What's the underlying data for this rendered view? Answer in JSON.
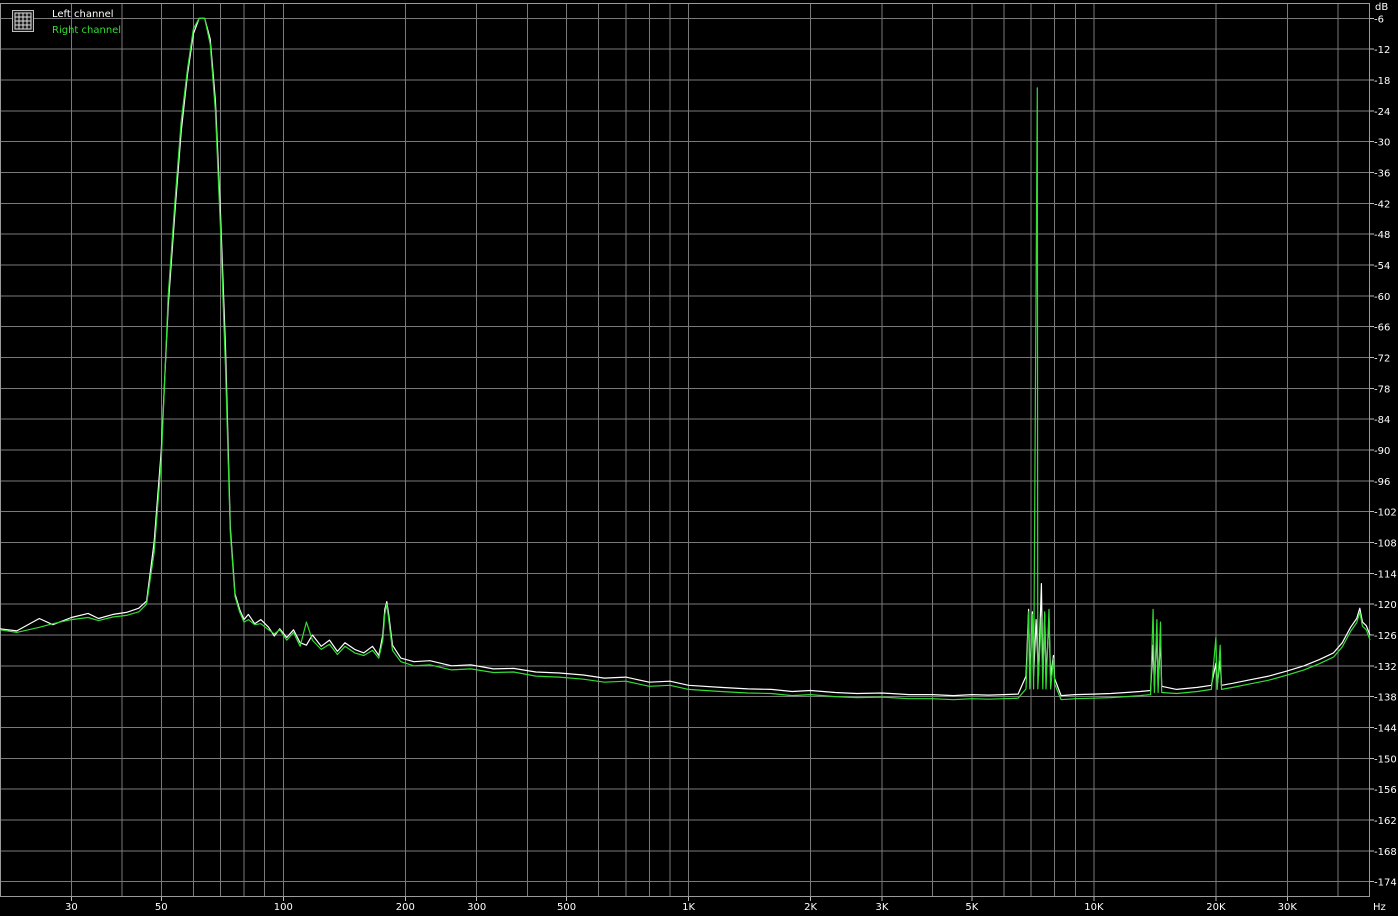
{
  "chart_data": {
    "type": "line",
    "title": "",
    "x_scale": "log",
    "xlim": [
      20,
      48000
    ],
    "ylim": [
      -177,
      -3
    ],
    "grid": true,
    "legend_position": "top-left",
    "x_unit": "Hz",
    "y_unit": "dB",
    "x_ticks": [
      {
        "value": 30,
        "label": "30"
      },
      {
        "value": 50,
        "label": "50"
      },
      {
        "value": 100,
        "label": "100"
      },
      {
        "value": 200,
        "label": "200"
      },
      {
        "value": 300,
        "label": "300"
      },
      {
        "value": 500,
        "label": "500"
      },
      {
        "value": 1000,
        "label": "1K"
      },
      {
        "value": 2000,
        "label": "2K"
      },
      {
        "value": 3000,
        "label": "3K"
      },
      {
        "value": 5000,
        "label": "5K"
      },
      {
        "value": 10000,
        "label": "10K"
      },
      {
        "value": 20000,
        "label": "20K"
      },
      {
        "value": 30000,
        "label": "30K"
      }
    ],
    "y_ticks": [
      -6,
      -12,
      -18,
      -24,
      -30,
      -36,
      -42,
      -48,
      -54,
      -60,
      -66,
      -72,
      -78,
      -84,
      -90,
      -96,
      -102,
      -108,
      -114,
      -120,
      -126,
      -132,
      -138,
      -144,
      -150,
      -156,
      -162,
      -168,
      -174
    ],
    "series": [
      {
        "name": "Left channel",
        "color": "#ffffff",
        "points": [
          [
            20,
            -124.8
          ],
          [
            22,
            -125.2
          ],
          [
            25,
            -122.8
          ],
          [
            27,
            -124.0
          ],
          [
            30,
            -122.6
          ],
          [
            33,
            -121.8
          ],
          [
            35,
            -122.8
          ],
          [
            38,
            -122.0
          ],
          [
            41,
            -121.6
          ],
          [
            44,
            -120.8
          ],
          [
            46,
            -119.4
          ],
          [
            48,
            -108
          ],
          [
            50,
            -90
          ],
          [
            52,
            -62
          ],
          [
            54,
            -44
          ],
          [
            56,
            -28
          ],
          [
            58,
            -17
          ],
          [
            60,
            -9
          ],
          [
            62,
            -6
          ],
          [
            64,
            -6
          ],
          [
            66,
            -10
          ],
          [
            68,
            -22
          ],
          [
            70,
            -44
          ],
          [
            72,
            -70
          ],
          [
            74,
            -105
          ],
          [
            76,
            -118
          ],
          [
            78,
            -121
          ],
          [
            80,
            -123
          ],
          [
            82,
            -122
          ],
          [
            85,
            -123.8
          ],
          [
            88,
            -123.0
          ],
          [
            92,
            -124.5
          ],
          [
            95,
            -126.2
          ],
          [
            98,
            -124.8
          ],
          [
            102,
            -126.5
          ],
          [
            106,
            -125.0
          ],
          [
            110,
            -127.5
          ],
          [
            114,
            -128.0
          ],
          [
            118,
            -126.0
          ],
          [
            124,
            -128.2
          ],
          [
            130,
            -127.0
          ],
          [
            136,
            -129.2
          ],
          [
            142,
            -127.5
          ],
          [
            150,
            -128.8
          ],
          [
            158,
            -129.5
          ],
          [
            166,
            -128.2
          ],
          [
            172,
            -130.0
          ],
          [
            176,
            -126
          ],
          [
            178,
            -121
          ],
          [
            180,
            -119.5
          ],
          [
            182,
            -122
          ],
          [
            186,
            -128
          ],
          [
            195,
            -130.5
          ],
          [
            210,
            -131.2
          ],
          [
            230,
            -131.0
          ],
          [
            260,
            -132.0
          ],
          [
            290,
            -131.8
          ],
          [
            330,
            -132.6
          ],
          [
            370,
            -132.5
          ],
          [
            420,
            -133.2
          ],
          [
            480,
            -133.4
          ],
          [
            550,
            -133.8
          ],
          [
            620,
            -134.4
          ],
          [
            700,
            -134.2
          ],
          [
            800,
            -135.2
          ],
          [
            900,
            -135.0
          ],
          [
            1000,
            -135.8
          ],
          [
            1200,
            -136.2
          ],
          [
            1400,
            -136.5
          ],
          [
            1600,
            -136.6
          ],
          [
            1800,
            -137.0
          ],
          [
            2000,
            -136.8
          ],
          [
            2300,
            -137.2
          ],
          [
            2600,
            -137.4
          ],
          [
            3000,
            -137.3
          ],
          [
            3500,
            -137.6
          ],
          [
            4000,
            -137.6
          ],
          [
            4500,
            -137.8
          ],
          [
            5000,
            -137.6
          ],
          [
            5500,
            -137.7
          ],
          [
            6000,
            -137.6
          ],
          [
            6500,
            -137.5
          ],
          [
            6800,
            -134.0
          ],
          [
            6900,
            -121.0
          ],
          [
            6950,
            -134.0
          ],
          [
            7050,
            -121.5
          ],
          [
            7100,
            -134.0
          ],
          [
            7200,
            -123.0
          ],
          [
            7300,
            -134.0
          ],
          [
            7420,
            -116.0
          ],
          [
            7480,
            -134.0
          ],
          [
            7560,
            -122.0
          ],
          [
            7620,
            -134.0
          ],
          [
            7750,
            -123.0
          ],
          [
            7820,
            -134.0
          ],
          [
            7950,
            -130.0
          ],
          [
            8000,
            -134.5
          ],
          [
            8300,
            -137.8
          ],
          [
            9000,
            -137.6
          ],
          [
            10000,
            -137.5
          ],
          [
            11000,
            -137.4
          ],
          [
            12000,
            -137.2
          ],
          [
            13000,
            -137.0
          ],
          [
            13800,
            -136.8
          ],
          [
            14000,
            -128.0
          ],
          [
            14100,
            -136.0
          ],
          [
            14300,
            -125.5
          ],
          [
            14400,
            -136.0
          ],
          [
            14600,
            -127.0
          ],
          [
            14700,
            -136.0
          ],
          [
            16000,
            -136.6
          ],
          [
            18000,
            -136.2
          ],
          [
            19500,
            -135.8
          ],
          [
            20000,
            -131.5
          ],
          [
            20150,
            -135.8
          ],
          [
            20500,
            -131.0
          ],
          [
            20650,
            -135.8
          ],
          [
            22000,
            -135.4
          ],
          [
            24000,
            -134.8
          ],
          [
            27000,
            -134.0
          ],
          [
            30000,
            -133.0
          ],
          [
            33000,
            -132.0
          ],
          [
            36000,
            -130.8
          ],
          [
            39000,
            -129.5
          ],
          [
            41000,
            -127.5
          ],
          [
            43000,
            -124.5
          ],
          [
            44500,
            -122.8
          ],
          [
            45300,
            -120.8
          ],
          [
            46000,
            -123.5
          ],
          [
            47000,
            -124.2
          ],
          [
            48000,
            -126.0
          ]
        ]
      },
      {
        "name": "Right channel",
        "color": "#33dd33",
        "points": [
          [
            20,
            -125.0
          ],
          [
            22,
            -125.5
          ],
          [
            25,
            -124.5
          ],
          [
            27,
            -123.8
          ],
          [
            30,
            -123.0
          ],
          [
            33,
            -122.6
          ],
          [
            35,
            -123.2
          ],
          [
            38,
            -122.5
          ],
          [
            41,
            -122.2
          ],
          [
            44,
            -121.5
          ],
          [
            46,
            -120.0
          ],
          [
            48,
            -110
          ],
          [
            50,
            -92
          ],
          [
            52,
            -60
          ],
          [
            54,
            -42
          ],
          [
            56,
            -26
          ],
          [
            58,
            -16
          ],
          [
            60,
            -8
          ],
          [
            62,
            -6
          ],
          [
            64,
            -6
          ],
          [
            66,
            -11
          ],
          [
            68,
            -24
          ],
          [
            70,
            -47
          ],
          [
            72,
            -74
          ],
          [
            74,
            -106
          ],
          [
            76,
            -118.5
          ],
          [
            78,
            -121.5
          ],
          [
            80,
            -123.5
          ],
          [
            82,
            -123
          ],
          [
            85,
            -124.0
          ],
          [
            88,
            -123.8
          ],
          [
            92,
            -125.0
          ],
          [
            95,
            -125.8
          ],
          [
            98,
            -125.0
          ],
          [
            102,
            -127.0
          ],
          [
            106,
            -125.5
          ],
          [
            110,
            -128.2
          ],
          [
            114,
            -123.5
          ],
          [
            118,
            -127.0
          ],
          [
            124,
            -128.8
          ],
          [
            130,
            -127.8
          ],
          [
            136,
            -129.8
          ],
          [
            142,
            -128.2
          ],
          [
            150,
            -129.5
          ],
          [
            158,
            -130.0
          ],
          [
            166,
            -129.0
          ],
          [
            172,
            -130.5
          ],
          [
            176,
            -127
          ],
          [
            178,
            -122
          ],
          [
            180,
            -120.0
          ],
          [
            182,
            -123
          ],
          [
            186,
            -129
          ],
          [
            195,
            -131.2
          ],
          [
            210,
            -132.0
          ],
          [
            230,
            -131.8
          ],
          [
            260,
            -132.8
          ],
          [
            290,
            -132.6
          ],
          [
            330,
            -133.3
          ],
          [
            370,
            -133.2
          ],
          [
            420,
            -134.0
          ],
          [
            480,
            -134.2
          ],
          [
            550,
            -134.6
          ],
          [
            620,
            -135.2
          ],
          [
            700,
            -135.0
          ],
          [
            800,
            -136.0
          ],
          [
            900,
            -135.8
          ],
          [
            1000,
            -136.6
          ],
          [
            1200,
            -137.0
          ],
          [
            1400,
            -137.3
          ],
          [
            1600,
            -137.4
          ],
          [
            1800,
            -137.8
          ],
          [
            2000,
            -137.6
          ],
          [
            2300,
            -138.0
          ],
          [
            2600,
            -138.2
          ],
          [
            3000,
            -138.1
          ],
          [
            3500,
            -138.4
          ],
          [
            4000,
            -138.4
          ],
          [
            4500,
            -138.6
          ],
          [
            5000,
            -138.4
          ],
          [
            5500,
            -138.5
          ],
          [
            6000,
            -138.4
          ],
          [
            6500,
            -138.3
          ],
          [
            6800,
            -136.5
          ],
          [
            6900,
            -121.5
          ],
          [
            6950,
            -136.5
          ],
          [
            7050,
            -122.0
          ],
          [
            7100,
            -136.5
          ],
          [
            7250,
            -19.5
          ],
          [
            7270,
            -136.5
          ],
          [
            7420,
            -122.5
          ],
          [
            7480,
            -136.5
          ],
          [
            7560,
            -121.5
          ],
          [
            7620,
            -136.5
          ],
          [
            7750,
            -121.0
          ],
          [
            7820,
            -136.5
          ],
          [
            7950,
            -130.5
          ],
          [
            8000,
            -135.5
          ],
          [
            8300,
            -138.6
          ],
          [
            9000,
            -138.4
          ],
          [
            10000,
            -138.3
          ],
          [
            11000,
            -138.2
          ],
          [
            12000,
            -138.0
          ],
          [
            13000,
            -137.8
          ],
          [
            13800,
            -137.6
          ],
          [
            14000,
            -121.0
          ],
          [
            14100,
            -137.2
          ],
          [
            14300,
            -123.0
          ],
          [
            14400,
            -137.2
          ],
          [
            14600,
            -123.5
          ],
          [
            14700,
            -137.2
          ],
          [
            16000,
            -137.4
          ],
          [
            18000,
            -137.0
          ],
          [
            19500,
            -136.6
          ],
          [
            20000,
            -126.5
          ],
          [
            20150,
            -136.6
          ],
          [
            20500,
            -128.0
          ],
          [
            20650,
            -136.6
          ],
          [
            22000,
            -136.2
          ],
          [
            24000,
            -135.6
          ],
          [
            27000,
            -134.8
          ],
          [
            30000,
            -133.8
          ],
          [
            33000,
            -132.8
          ],
          [
            36000,
            -131.6
          ],
          [
            39000,
            -130.3
          ],
          [
            41000,
            -128.3
          ],
          [
            43000,
            -125.3
          ],
          [
            44500,
            -123.6
          ],
          [
            45300,
            -121.6
          ],
          [
            46000,
            -124.3
          ],
          [
            47000,
            -125.0
          ],
          [
            48000,
            -127.0
          ]
        ]
      }
    ]
  }
}
